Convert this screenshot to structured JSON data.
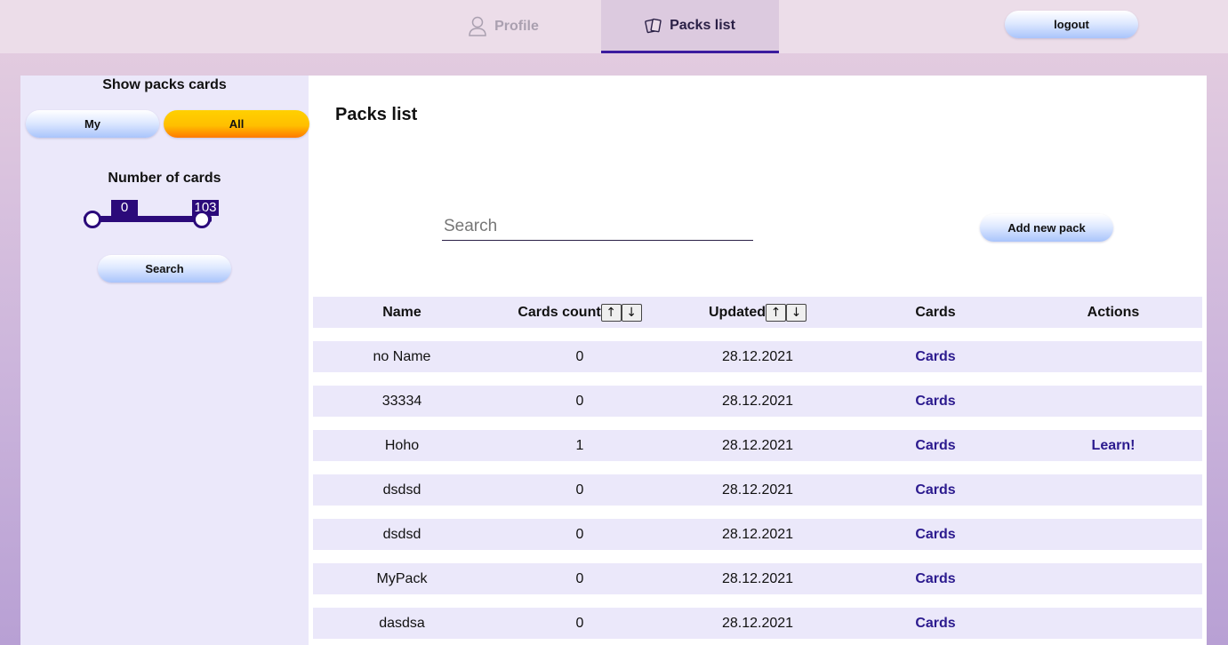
{
  "header": {
    "tabs": [
      {
        "label": "Profile",
        "icon": "user-icon",
        "active": false
      },
      {
        "label": "Packs list",
        "icon": "cards-icon",
        "active": true
      }
    ],
    "logout_label": "logout",
    "accent_color": "#3b1b9e"
  },
  "sidebar": {
    "show_title": "Show packs cards",
    "my_label": "My",
    "all_label": "All",
    "cards_title": "Number of cards",
    "range_min": "0",
    "range_max": "103",
    "search_label": "Search"
  },
  "main": {
    "title": "Packs list",
    "search_placeholder": "Search",
    "add_label": "Add new pack"
  },
  "table": {
    "headers": [
      "Name",
      "Cards count",
      "Updated",
      "Cards",
      "Actions"
    ],
    "sort_up": "↑",
    "sort_down": "↓",
    "rows": [
      {
        "name": "no Name",
        "count": "0",
        "updated": "28.12.2021",
        "cards": "Cards",
        "action": ""
      },
      {
        "name": "33334",
        "count": "0",
        "updated": "28.12.2021",
        "cards": "Cards",
        "action": ""
      },
      {
        "name": "Hoho",
        "count": "1",
        "updated": "28.12.2021",
        "cards": "Cards",
        "action": "Learn!"
      },
      {
        "name": "dsdsd",
        "count": "0",
        "updated": "28.12.2021",
        "cards": "Cards",
        "action": ""
      },
      {
        "name": "dsdsd",
        "count": "0",
        "updated": "28.12.2021",
        "cards": "Cards",
        "action": ""
      },
      {
        "name": "MyPack",
        "count": "0",
        "updated": "28.12.2021",
        "cards": "Cards",
        "action": ""
      },
      {
        "name": "dasdsa",
        "count": "0",
        "updated": "28.12.2021",
        "cards": "Cards",
        "action": ""
      }
    ]
  }
}
